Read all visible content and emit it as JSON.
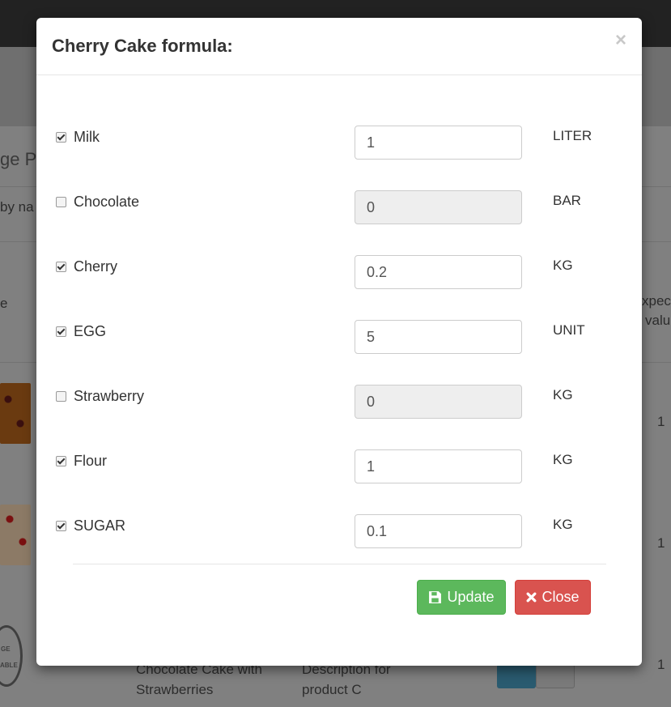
{
  "background": {
    "title_fragment": "ge P",
    "filter_fragment": "by na",
    "column_fragment": "e",
    "expected_fragment_1": "xpec",
    "expected_fragment_2": "valu",
    "row_values": [
      "1",
      "1",
      "1"
    ],
    "last_row_name": "Chocolate Cake with Strawberries",
    "last_row_desc": "Description for product C",
    "logo_text": [
      "GE",
      "ABLE"
    ]
  },
  "modal": {
    "title": "Cherry Cake formula:",
    "close_symbol": "×",
    "ingredients": [
      {
        "name": "Milk",
        "checked": true,
        "value": "1",
        "unit": "LITER"
      },
      {
        "name": "Chocolate",
        "checked": false,
        "value": "0",
        "unit": "BAR"
      },
      {
        "name": "Cherry",
        "checked": true,
        "value": "0.2",
        "unit": "KG"
      },
      {
        "name": "EGG",
        "checked": true,
        "value": "5",
        "unit": "UNIT"
      },
      {
        "name": "Strawberry",
        "checked": false,
        "value": "0",
        "unit": "KG"
      },
      {
        "name": "Flour",
        "checked": true,
        "value": "1",
        "unit": "KG"
      },
      {
        "name": "SUGAR",
        "checked": true,
        "value": "0.1",
        "unit": "KG"
      }
    ],
    "update_label": "Update",
    "close_label": "Close"
  },
  "colors": {
    "update": "#5cb85c",
    "close": "#d9534f"
  }
}
